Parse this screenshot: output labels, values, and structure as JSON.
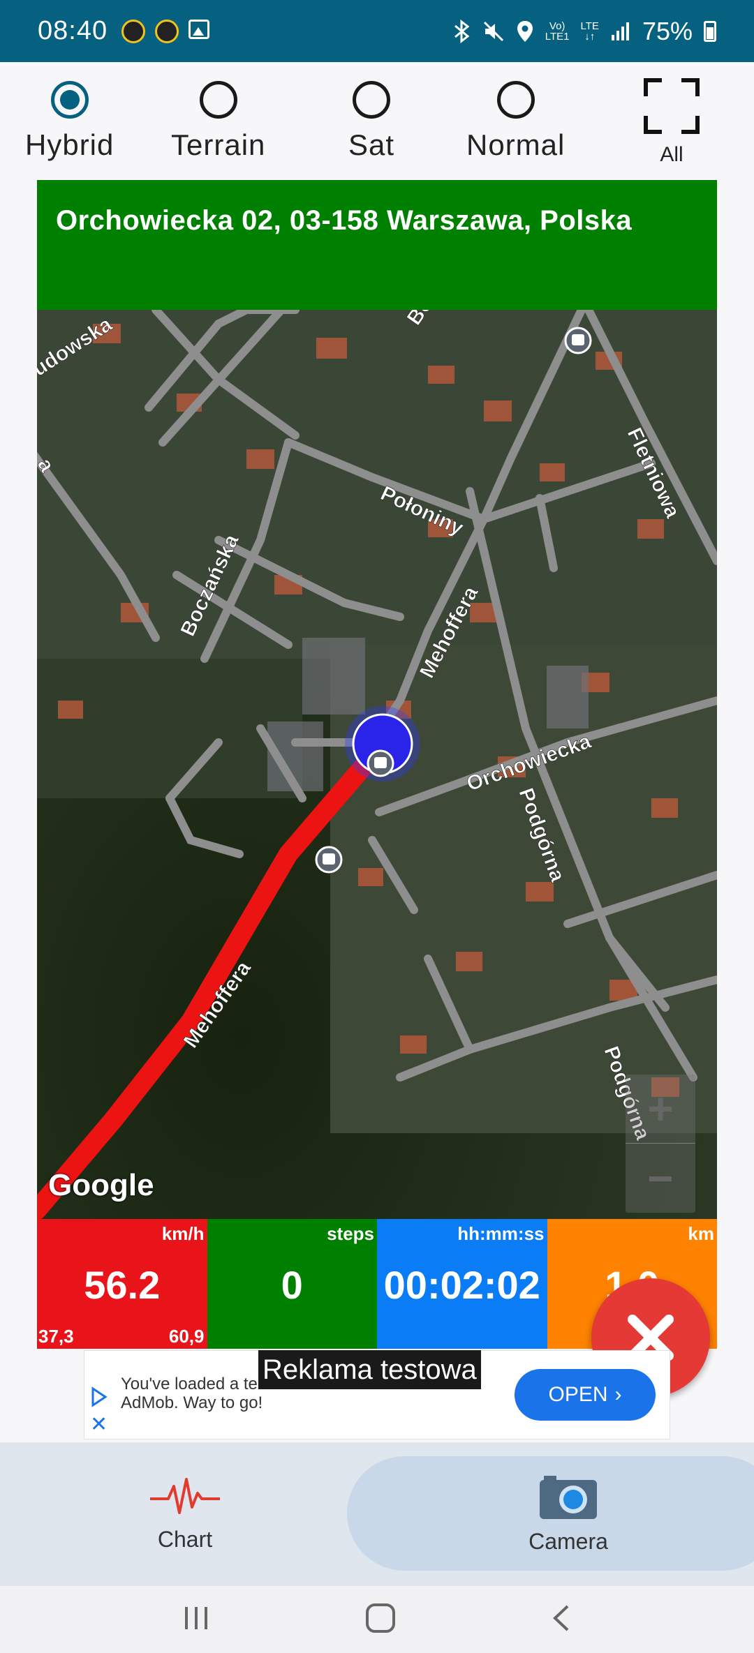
{
  "status_bar": {
    "time": "08:40",
    "battery": "75%",
    "network_top": "Vo)",
    "network_bottom": "LTE1",
    "lte_label": "LTE"
  },
  "map_types": {
    "options": [
      "Hybrid",
      "Terrain",
      "Sat",
      "Normal"
    ],
    "selected": "Hybrid",
    "all_label": "All"
  },
  "address": "Orchowiecka 02, 03-158 Warszawa, Polska",
  "map": {
    "street_labels": [
      "udowska",
      "a",
      "Bo",
      "Fletniowa",
      "Połoniny",
      "Boczańska",
      "Mehoffera",
      "Orchowiecka",
      "Podgórna",
      "Mehoffera",
      "Podgórna"
    ],
    "attribution": "Google",
    "zoom_in": "+",
    "zoom_out": "−"
  },
  "stats": {
    "speed": {
      "unit": "km/h",
      "value": "56.2",
      "min": "37,3",
      "max": "60,9",
      "color": "#e8141a"
    },
    "steps": {
      "unit": "steps",
      "value": "0",
      "color": "#008000"
    },
    "time": {
      "unit": "hh:mm:ss",
      "value": "00:02:02",
      "color": "#0a7cf5"
    },
    "distance": {
      "unit": "km",
      "value": "1,0",
      "color": "#ff8200"
    }
  },
  "ad": {
    "tag": "Reklama testowa",
    "text": "You've loaded a test ad from AdMob. Way to go!",
    "button": "OPEN"
  },
  "bottom_nav": {
    "chart_label": "Chart",
    "camera_label": "Camera"
  }
}
